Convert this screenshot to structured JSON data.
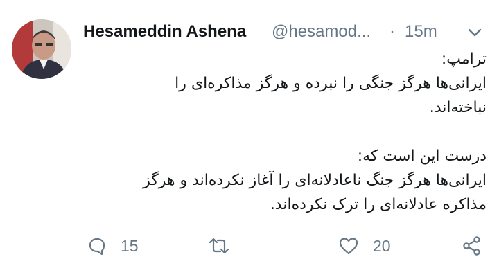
{
  "tweet": {
    "author_name": "Hesameddin Ashena",
    "handle": "@hesamod...",
    "separator": "·",
    "time": "15m",
    "body_lines": [
      "ترامپ:",
      "ایرانی‌ها هرگز جنگی را نبرده و هرگز مذاکره‌ای را",
      "نباخته‌اند.",
      "",
      "درست این است که:",
      "ایرانی‌ها هرگز جنگ ناعادلانه‌ای را آغاز نکرده‌اند و هرگز",
      "مذاکره عادلانه‌ای را ترک نکرده‌اند."
    ],
    "reply_count": "15",
    "retweet_count": "",
    "like_count": "20"
  },
  "icons": {
    "reply": "speech-bubble-icon",
    "retweet": "retweet-icon",
    "like": "heart-icon",
    "share": "share-icon",
    "menu": "chevron-down-icon"
  },
  "colors": {
    "text": "#14171a",
    "secondary": "#657786"
  }
}
